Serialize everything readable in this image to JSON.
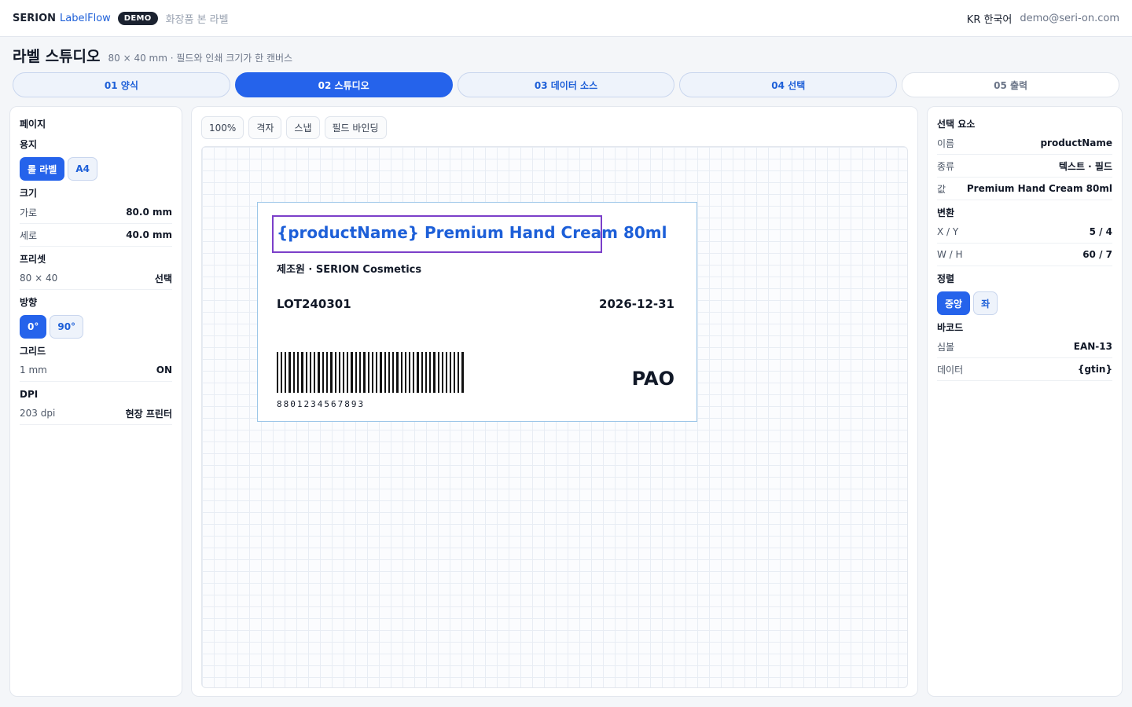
{
  "header": {
    "brand": "SERION",
    "brand_accent": "LabelFlow",
    "badge": "DEMO",
    "subtitle": "화장품 본 라벨",
    "lang": "KR 한국어",
    "email": "demo@seri-on.com"
  },
  "page": {
    "title": "라벨 스튜디오",
    "subtitle": "80 × 40 mm · 필드와 인쇄 크기가 한 캔버스"
  },
  "steps": [
    {
      "label": "01 양식",
      "state": "done"
    },
    {
      "label": "02 스튜디오",
      "state": "active"
    },
    {
      "label": "03 데이터 소스",
      "state": "done"
    },
    {
      "label": "04 선택",
      "state": "done"
    },
    {
      "label": "05 출력",
      "state": "future"
    }
  ],
  "left": {
    "page_title": "페이지",
    "paper_title": "용지",
    "paper_options": [
      "롤 라벨",
      "A4"
    ],
    "size_title": "크기",
    "width_label": "가로",
    "width_value": "80.0 mm",
    "height_label": "세로",
    "height_value": "40.0 mm",
    "preset_title": "프리셋",
    "preset_label": "80 × 40",
    "preset_value": "선택",
    "orient_title": "방향",
    "orient_options": [
      "0°",
      "90°"
    ],
    "grid_title": "그리드",
    "grid_label": "1 mm",
    "grid_value": "ON",
    "dpi_title": "DPI",
    "dpi_label": "203 dpi",
    "dpi_value": "현장 프린터"
  },
  "toolbar": {
    "zoom": "100%",
    "grid": "격자",
    "snap": "스냅",
    "binding": "필드 바인딩"
  },
  "label": {
    "title": "{productName} Premium Hand Cream 80ml",
    "maker": "제조원 · SERION Cosmetics",
    "lot": "LOT240301",
    "expiry": "2026-12-31",
    "barcode_number": "8801234567893",
    "pao": "PAO"
  },
  "right": {
    "selection_title": "선택 요소",
    "name_label": "이름",
    "name_value": "productName",
    "type_label": "종류",
    "type_value": "텍스트 · 필드",
    "value_label": "값",
    "value_value": "Premium Hand Cream 80ml",
    "transform_title": "변환",
    "xy_label": "X / Y",
    "xy_value": "5 / 4",
    "wh_label": "W / H",
    "wh_value": "60 / 7",
    "align_title": "정렬",
    "align_options": [
      "중앙",
      "좌"
    ],
    "barcode_title": "바코드",
    "symbol_label": "심볼",
    "symbol_value": "EAN-13",
    "data_label": "데이터",
    "data_value": "{gtin}"
  },
  "colors": {
    "accent": "#2563eb",
    "selection": "#7b3fc9",
    "label_border": "#9cc6e8"
  }
}
